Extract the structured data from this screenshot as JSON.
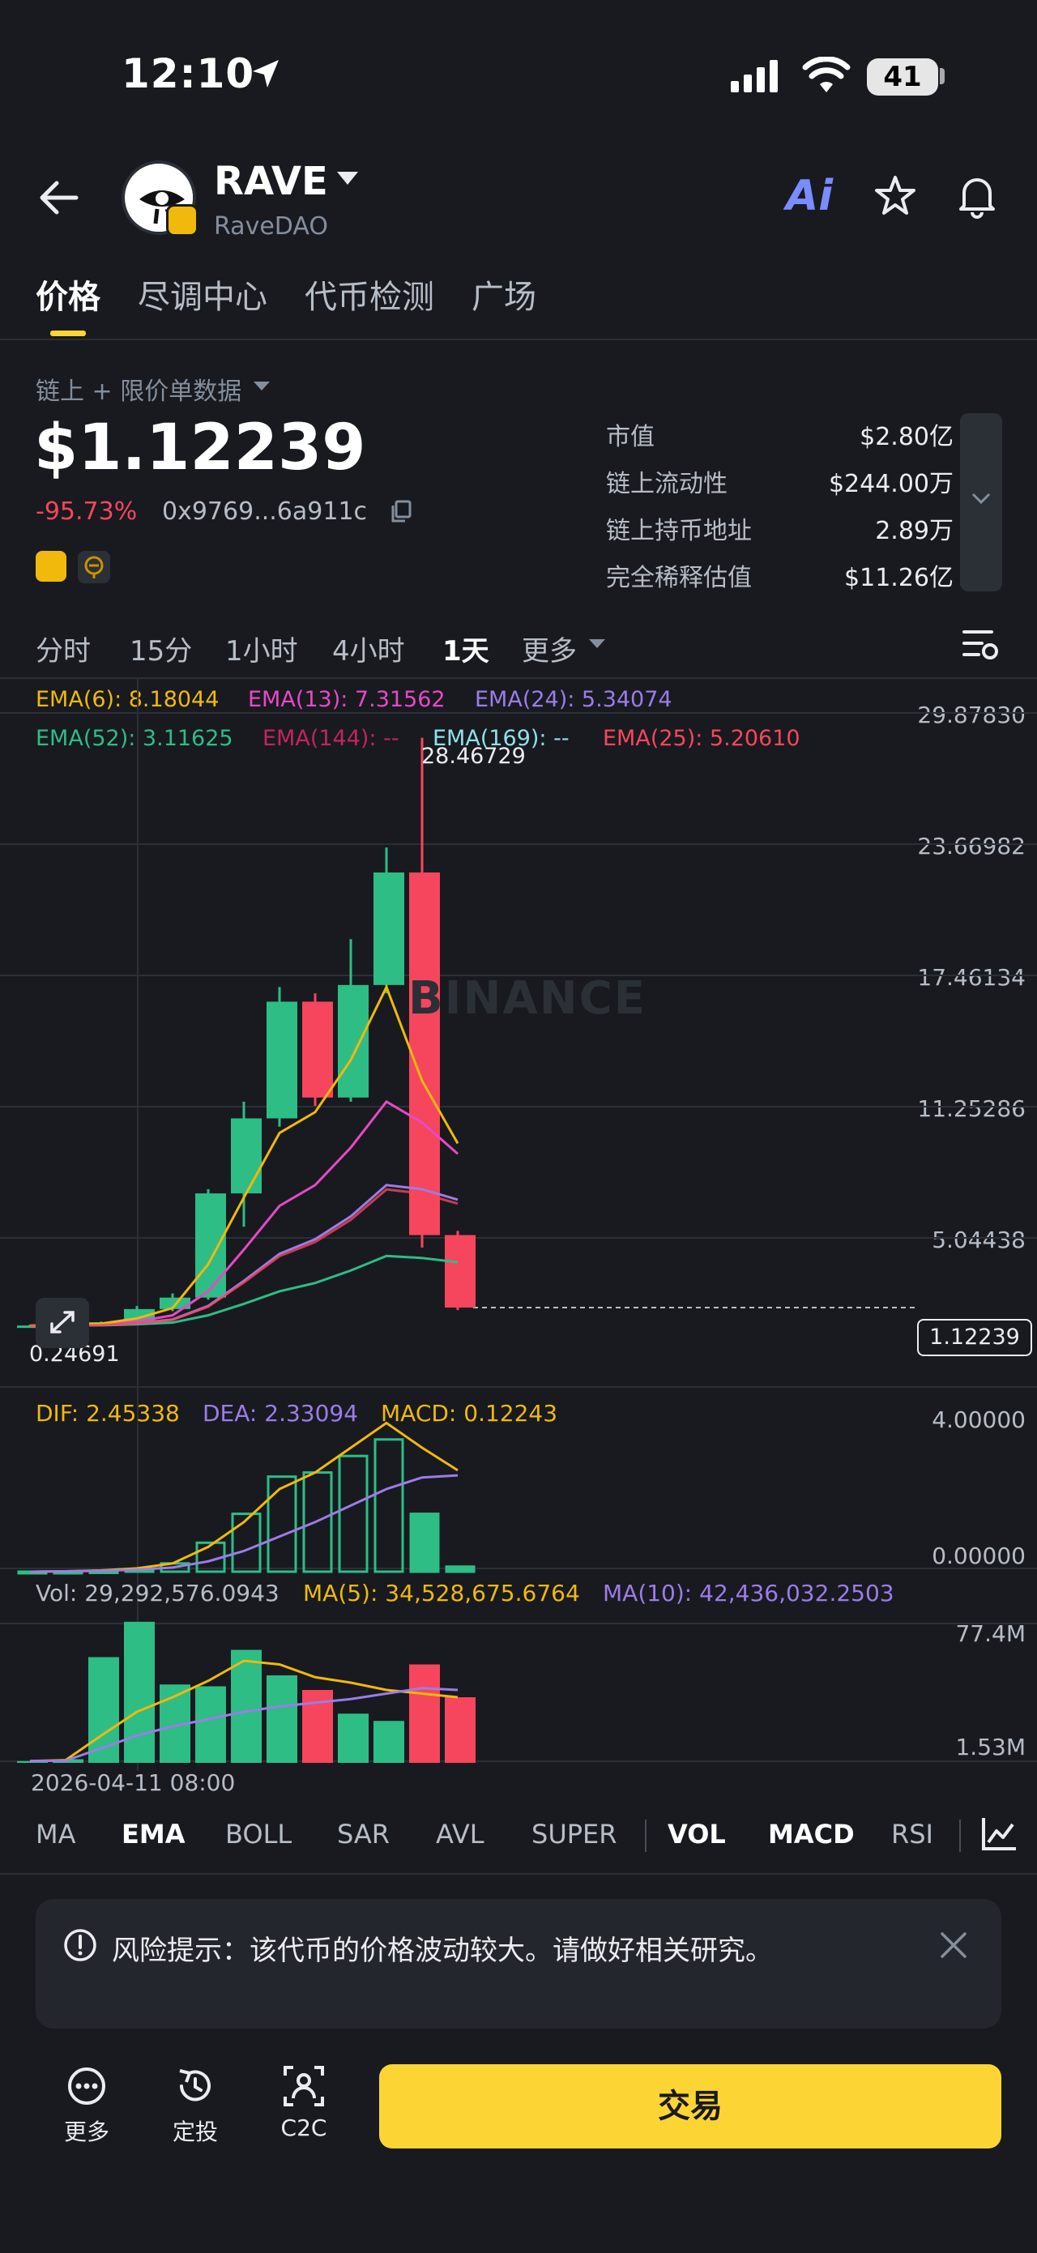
{
  "status_bar": {
    "time": "12:10",
    "battery": "41"
  },
  "header": {
    "token_name": "RAVE",
    "token_full_name": "RaveDAO"
  },
  "tabs": [
    "价格",
    "尽调中心",
    "代币检测",
    "广场"
  ],
  "price_panel": {
    "source_label": "链上 + 限价单数据",
    "price": "$1.12239",
    "change": "-95.73%",
    "contract": "0x9769...6a911c",
    "stats": [
      {
        "label": "市值",
        "value": "$2.80亿"
      },
      {
        "label": "链上流动性",
        "value": "$244.00万"
      },
      {
        "label": "链上持币地址",
        "value": "2.89万"
      },
      {
        "label": "完全稀释估值",
        "value": "$11.26亿"
      }
    ]
  },
  "timeframes": [
    "分时",
    "15分",
    "1小时",
    "4小时",
    "1天",
    "更多"
  ],
  "ema_legend": {
    "row1": [
      {
        "text": "EMA(6): 8.18044",
        "color": "#f0b90b"
      },
      {
        "text": "EMA(13): 7.31562",
        "color": "#e749c5"
      },
      {
        "text": "EMA(24): 5.34074",
        "color": "#9c7ce8"
      }
    ],
    "row2": [
      {
        "text": "EMA(52): 3.11625",
        "color": "#2ebd85"
      },
      {
        "text": "EMA(144): --",
        "color": "#c2255c"
      },
      {
        "text": "EMA(169): --",
        "color": "#8ee2e8"
      },
      {
        "text": "EMA(25): 5.20610",
        "color": "#f6465d"
      }
    ]
  },
  "price_axis": [
    "29.87830",
    "23.66982",
    "17.46134",
    "11.25286",
    "5.04438"
  ],
  "high_label": "28.46729",
  "low_label": "0.24691",
  "last_price_tag": "1.12239",
  "watermark": "BINANCE",
  "macd_legend": {
    "dif": "DIF: 2.45338",
    "dea": "DEA: 2.33094",
    "macd": "MACD: 0.12243"
  },
  "macd_axis": [
    "4.00000",
    "0.00000"
  ],
  "vol_legend": {
    "vol": "Vol: 29,292,576.0943",
    "ma5": "MA(5): 34,528,675.6764",
    "ma10": "MA(10): 42,436,032.2503"
  },
  "vol_axis": [
    "77.4M",
    "1.53M"
  ],
  "date_label": "2026-04-11 08:00",
  "indicators": [
    "MA",
    "EMA",
    "BOLL",
    "SAR",
    "AVL",
    "SUPER",
    "VOL",
    "MACD",
    "RSI"
  ],
  "risk": {
    "text": "风险提示：该代币的价格波动较大。请做好相关研究。"
  },
  "bottom_nav": {
    "more": "更多",
    "dca": "定投",
    "c2c": "C2C",
    "trade": "交易"
  },
  "chart_data": {
    "type": "candlestick",
    "candles": [
      {
        "o": 0.24,
        "h": 0.3,
        "l": 0.22,
        "c": 0.26
      },
      {
        "o": 0.26,
        "h": 0.35,
        "l": 0.24,
        "c": 0.3
      },
      {
        "o": 0.3,
        "h": 0.45,
        "l": 0.28,
        "c": 0.42
      },
      {
        "o": 0.42,
        "h": 1.2,
        "l": 0.4,
        "c": 1.05
      },
      {
        "o": 1.05,
        "h": 1.8,
        "l": 0.95,
        "c": 1.6
      },
      {
        "o": 1.6,
        "h": 6.8,
        "l": 1.5,
        "c": 6.6
      },
      {
        "o": 6.6,
        "h": 11.0,
        "l": 5.0,
        "c": 10.2
      },
      {
        "o": 10.2,
        "h": 16.5,
        "l": 9.8,
        "c": 15.8
      },
      {
        "o": 15.8,
        "h": 16.2,
        "l": 10.8,
        "c": 11.2
      },
      {
        "o": 11.2,
        "h": 18.8,
        "l": 11.0,
        "c": 16.6
      },
      {
        "o": 16.6,
        "h": 23.2,
        "l": 16.2,
        "c": 22.0
      },
      {
        "o": 22.0,
        "h": 28.46729,
        "l": 4.0,
        "c": 4.6
      },
      {
        "o": 4.6,
        "h": 4.8,
        "l": 1.0,
        "c": 1.12239
      }
    ],
    "ema6": [
      0.25,
      0.28,
      0.35,
      0.6,
      1.1,
      3.2,
      6.4,
      9.5,
      10.5,
      13.0,
      16.5,
      12.0,
      9.0
    ],
    "ema13": [
      0.25,
      0.27,
      0.31,
      0.45,
      0.75,
      1.9,
      3.9,
      6.0,
      7.0,
      8.8,
      11.0,
      10.0,
      8.5
    ],
    "ema24": [
      0.25,
      0.26,
      0.29,
      0.38,
      0.55,
      1.2,
      2.4,
      3.7,
      4.4,
      5.5,
      7.0,
      6.8,
      6.3
    ],
    "ema52": [
      0.25,
      0.26,
      0.27,
      0.32,
      0.4,
      0.75,
      1.3,
      1.9,
      2.3,
      2.9,
      3.6,
      3.5,
      3.3
    ],
    "ylim": [
      -0.9,
      30.2
    ],
    "macd": {
      "dif": [
        0.0,
        0.01,
        0.03,
        0.08,
        0.2,
        0.6,
        1.2,
        2.0,
        2.4,
        3.0,
        3.6,
        3.0,
        2.45338
      ],
      "dea": [
        0.0,
        0.01,
        0.02,
        0.05,
        0.1,
        0.25,
        0.5,
        0.85,
        1.2,
        1.6,
        2.0,
        2.28,
        2.33094
      ],
      "hist": [
        0.0,
        0.0,
        0.01,
        0.06,
        0.2,
        0.7,
        1.4,
        2.3,
        2.4,
        2.8,
        3.2,
        1.4,
        0.12243
      ],
      "ylim": [
        0,
        4
      ]
    },
    "volume": {
      "values": [
        1.0,
        2.0,
        58,
        77.4,
        43,
        42,
        62,
        48,
        40,
        27,
        23,
        54,
        36
      ],
      "ma5": [
        1.0,
        1.5,
        15,
        28,
        36,
        45,
        56,
        54,
        47,
        44,
        40,
        38,
        36
      ],
      "ma10": [
        1.0,
        1.2,
        8,
        15,
        20,
        24,
        28,
        31,
        33,
        35,
        38,
        41,
        40
      ],
      "ylim": [
        0,
        80
      ]
    }
  }
}
